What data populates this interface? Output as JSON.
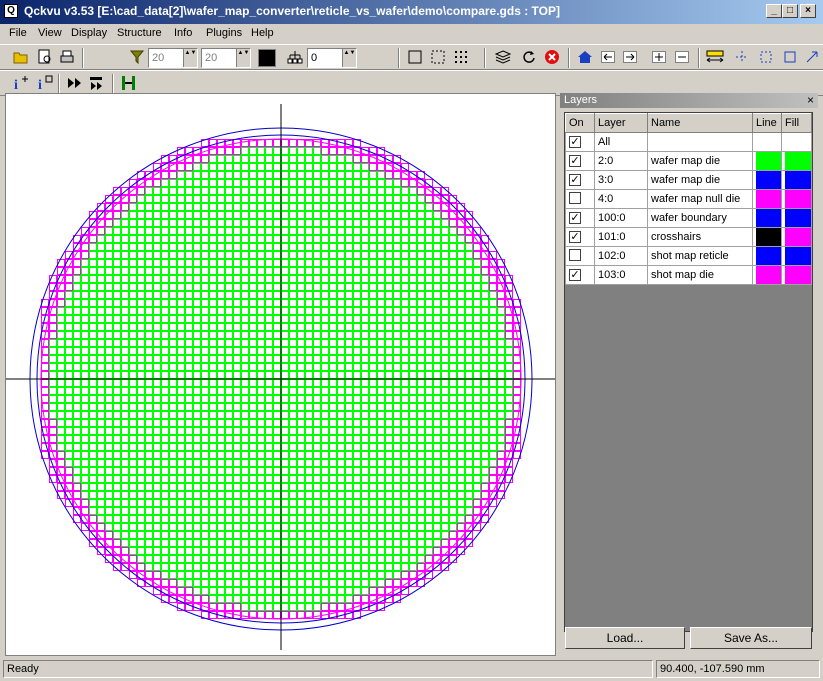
{
  "window": {
    "title": "Qckvu v3.53 [E:\\cad_data[2]\\wafer_map_converter\\reticle_vs_wafer\\demo\\compare.gds : TOP]",
    "app_icon_glyph": "Q",
    "minimize": "_",
    "maximize": "□",
    "close": "×"
  },
  "menu": [
    "File",
    "View",
    "Display",
    "Structure",
    "Info",
    "Plugins",
    "Help"
  ],
  "toolbar": {
    "spin1_value": "20",
    "spin2_value": "20",
    "spin3_value": "0",
    "spin_arrows": "▲▼",
    "color_swatch": "#000000"
  },
  "layers_panel": {
    "title": "Layers",
    "close": "×",
    "columns": [
      "On",
      "Layer",
      "Name",
      "Line",
      "Fill"
    ],
    "rows": [
      {
        "on": true,
        "layer": "All",
        "name": "",
        "line": "#ffffff",
        "fill": "#ffffff"
      },
      {
        "on": true,
        "layer": "2:0",
        "name": "wafer map die",
        "line": "#00ff00",
        "fill": "#00ff00"
      },
      {
        "on": true,
        "layer": "3:0",
        "name": "wafer map die",
        "line": "#0000ff",
        "fill": "#0000ff"
      },
      {
        "on": false,
        "layer": "4:0",
        "name": "wafer map null die",
        "line": "#ff00ff",
        "fill": "#ff00ff"
      },
      {
        "on": true,
        "layer": "100:0",
        "name": "wafer boundary",
        "line": "#0000ff",
        "fill": "#0000ff"
      },
      {
        "on": true,
        "layer": "101:0",
        "name": "crosshairs",
        "line": "#000000",
        "fill": "#ff00ff"
      },
      {
        "on": false,
        "layer": "102:0",
        "name": "shot map reticle",
        "line": "#0000ff",
        "fill": "#0000ff"
      },
      {
        "on": true,
        "layer": "103:0",
        "name": "shot map die",
        "line": "#ff00ff",
        "fill": "#ff00ff"
      }
    ],
    "load_label": "Load...",
    "save_label": "Save As..."
  },
  "status": {
    "left": "Ready",
    "coords": "90.400, -107.590 mm"
  },
  "colors": {
    "die_green": "#00ff00",
    "shot_magenta": "#ff00ff",
    "boundary_blue": "#0000cc"
  }
}
